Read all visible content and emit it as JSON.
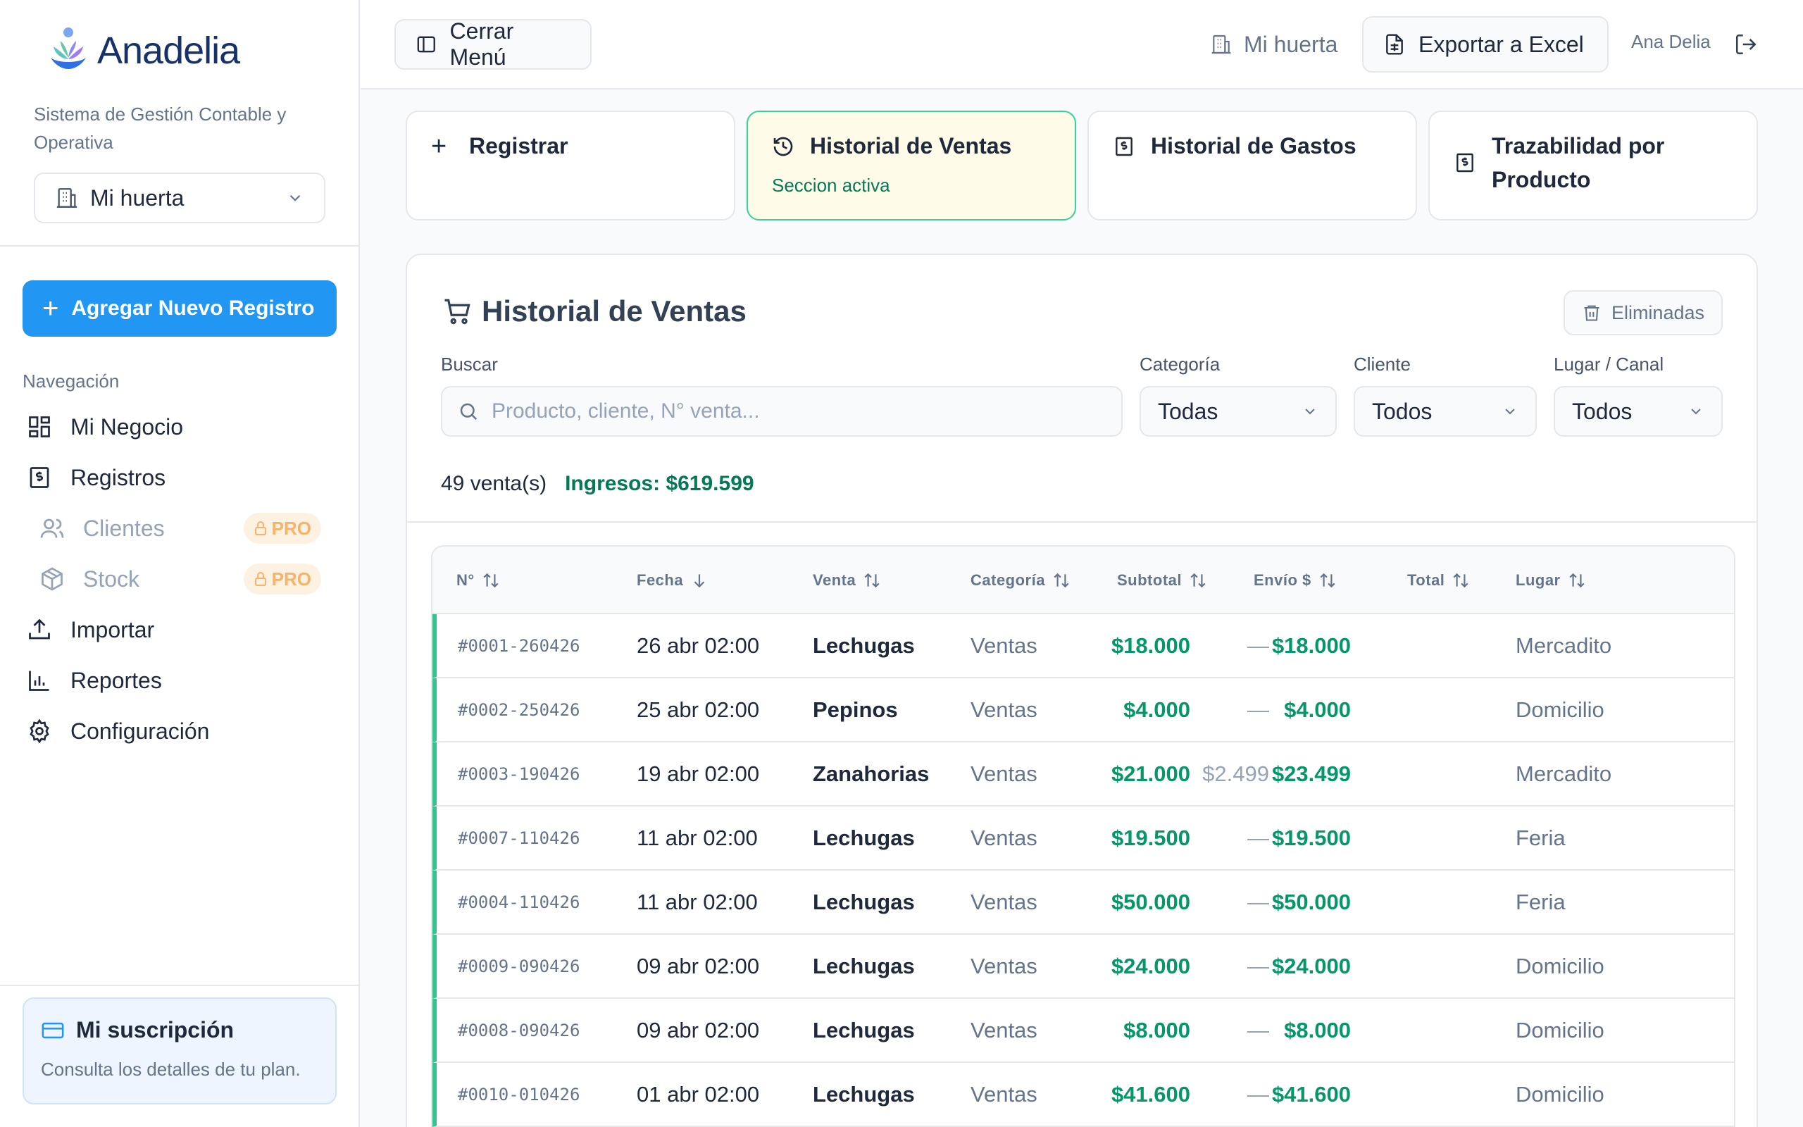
{
  "brand": {
    "name": "Anadelia",
    "tagline": "Sistema de Gestión Contable y Operativa"
  },
  "sidebar": {
    "farm_selector": "Mi huerta",
    "add_button": "Agregar Nuevo Registro",
    "nav_label": "Navegación",
    "items": [
      {
        "label": "Mi Negocio",
        "icon": "dashboard-icon"
      },
      {
        "label": "Registros",
        "icon": "receipt-icon"
      },
      {
        "label": "Clientes",
        "icon": "users-icon",
        "badge": "PRO"
      },
      {
        "label": "Stock",
        "icon": "box-icon",
        "badge": "PRO"
      },
      {
        "label": "Importar",
        "icon": "upload-icon"
      },
      {
        "label": "Reportes",
        "icon": "bar-chart-icon"
      },
      {
        "label": "Configuración",
        "icon": "gear-icon"
      }
    ],
    "subscription": {
      "title": "Mi suscripción",
      "desc": "Consulta los detalles de tu plan."
    }
  },
  "topbar": {
    "close_menu": "Cerrar Menú",
    "farm": "Mi huerta",
    "export": "Exportar a Excel",
    "user": "Ana Delia"
  },
  "tabs": [
    {
      "label": "Registrar"
    },
    {
      "label": "Historial de Ventas",
      "sub": "Seccion activa",
      "active": true
    },
    {
      "label": "Historial de Gastos"
    },
    {
      "label": "Trazabilidad por Producto"
    }
  ],
  "sales": {
    "title": "Historial de Ventas",
    "deleted_button": "Eliminadas",
    "filters": {
      "search_label": "Buscar",
      "search_placeholder": "Producto, cliente, N° venta...",
      "category_label": "Categoría",
      "category_value": "Todas",
      "client_label": "Cliente",
      "client_value": "Todos",
      "place_label": "Lugar / Canal",
      "place_value": "Todos"
    },
    "summary": {
      "count": "49 venta(s)",
      "income": "Ingresos: $619.599"
    },
    "columns": [
      "N°",
      "Fecha",
      "Venta",
      "Categoría",
      "Subtotal",
      "Envío $",
      "Total",
      "Lugar"
    ],
    "rows": [
      {
        "num": "#0001-260426",
        "fecha": "26 abr 02:00",
        "venta": "Lechugas",
        "cat": "Ventas",
        "subtotal": "$18.000",
        "envio": "—",
        "total": "$18.000",
        "lugar": "Mercadito"
      },
      {
        "num": "#0002-250426",
        "fecha": "25 abr 02:00",
        "venta": "Pepinos",
        "cat": "Ventas",
        "subtotal": "$4.000",
        "envio": "—",
        "total": "$4.000",
        "lugar": "Domicilio"
      },
      {
        "num": "#0003-190426",
        "fecha": "19 abr 02:00",
        "venta": "Zanahorias",
        "cat": "Ventas",
        "subtotal": "$21.000",
        "envio": "$2.499",
        "total": "$23.499",
        "lugar": "Mercadito"
      },
      {
        "num": "#0007-110426",
        "fecha": "11 abr 02:00",
        "venta": "Lechugas",
        "cat": "Ventas",
        "subtotal": "$19.500",
        "envio": "—",
        "total": "$19.500",
        "lugar": "Feria"
      },
      {
        "num": "#0004-110426",
        "fecha": "11 abr 02:00",
        "venta": "Lechugas",
        "cat": "Ventas",
        "subtotal": "$50.000",
        "envio": "—",
        "total": "$50.000",
        "lugar": "Feria"
      },
      {
        "num": "#0009-090426",
        "fecha": "09 abr 02:00",
        "venta": "Lechugas",
        "cat": "Ventas",
        "subtotal": "$24.000",
        "envio": "—",
        "total": "$24.000",
        "lugar": "Domicilio"
      },
      {
        "num": "#0008-090426",
        "fecha": "09 abr 02:00",
        "venta": "Lechugas",
        "cat": "Ventas",
        "subtotal": "$8.000",
        "envio": "—",
        "total": "$8.000",
        "lugar": "Domicilio"
      },
      {
        "num": "#0010-010426",
        "fecha": "01 abr 02:00",
        "venta": "Lechugas",
        "cat": "Ventas",
        "subtotal": "$41.600",
        "envio": "—",
        "total": "$41.600",
        "lugar": "Domicilio"
      }
    ]
  },
  "colors": {
    "primary": "#2196f3",
    "success": "#059669",
    "active_tab_bg": "#fefce8",
    "row_accent": "#34c38f"
  }
}
